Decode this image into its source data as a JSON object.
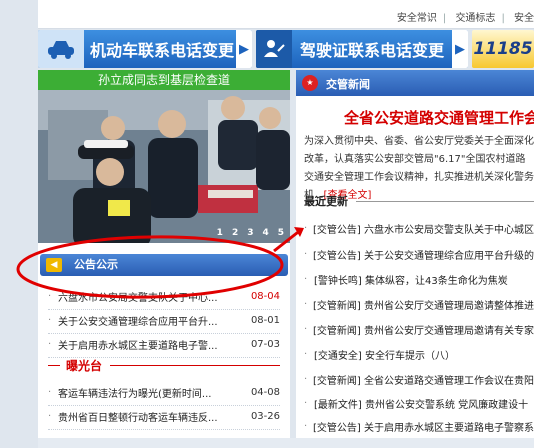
{
  "toplinks": [
    "安全常识",
    "交通标志",
    "安全"
  ],
  "banners": {
    "vehicle": {
      "label": "机动车联系电话变更",
      "icon": "car-icon"
    },
    "license": {
      "label": "驾驶证联系电话变更",
      "icon": "person-edit-icon"
    },
    "partial": {
      "label": "11185"
    }
  },
  "photo": {
    "title": "孙立成同志到基层检查道",
    "pages": [
      "1",
      "2",
      "3",
      "4",
      "5"
    ]
  },
  "notice": {
    "title": "公告公示",
    "items": [
      {
        "text": "六盘水市公安局交警支队关于中心...",
        "date": "08-04",
        "highlight": true
      },
      {
        "text": "关于公安交通管理综合应用平台升...",
        "date": "08-01",
        "highlight": false
      },
      {
        "text": "关于启用赤水城区主要道路电子警...",
        "date": "07-03",
        "highlight": false
      }
    ],
    "exposure_title": "曝光台",
    "exposure_items": [
      {
        "text": "客运车辆违法行为曝光(更新时间...",
        "date": "04-08"
      },
      {
        "text": "贵州省百日整顿行动客运车辆违反...",
        "date": "03-26"
      }
    ]
  },
  "news": {
    "title": "交管新闻",
    "headline": "全省公安道路交通管理工作会",
    "summary": "为深入贯彻中央、省委、省公安厅党委关于全面深化改革，认真落实公安部交管局\"6.17\"全国农村道路交通安全管理工作会议精神，扎实推进机关深化警务机...",
    "summary_link": "[查看全文]",
    "latest_title": "最近更新",
    "items": [
      "[交管公告] 六盘水市公安局交警支队关于中心城区",
      "[交管公告] 关于公安交通管理综合应用平台升级的",
      "[警钟长鸣] 集体纵容，让43条生命化为焦炭",
      "[交管新闻] 贵州省公安厅交通管理局邀请整体推进",
      "[交管新闻] 贵州省公安厅交通管理局邀请有关专家",
      "[交通安全] 安全行车提示（八）",
      "[交管新闻] 全省公安道路交通管理工作会议在贵阳",
      "[最新文件] 贵州省公安交警系统 党风廉政建设十",
      "[交管公告] 关于启用赤水城区主要道路电子警察系"
    ]
  },
  "colors": {
    "accent": "#2a5db3",
    "alert": "#d40000",
    "photo_title_bg": "#3cae35"
  }
}
